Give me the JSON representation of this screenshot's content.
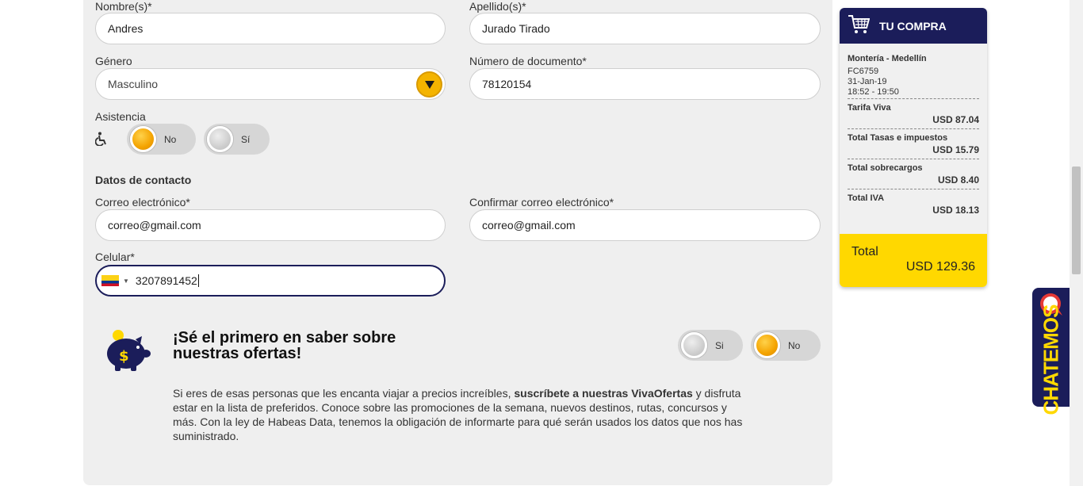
{
  "form": {
    "nombres_label": "Nombre(s)*",
    "nombres_value": "Andres",
    "apellidos_label": "Apellido(s)*",
    "apellidos_value": "Jurado Tirado",
    "genero_label": "Género",
    "genero_value": "Masculino",
    "documento_label": "Número de documento*",
    "documento_value": "78120154",
    "asistencia_label": "Asistencia",
    "asistencia_no": "No",
    "asistencia_si": "Sí",
    "contacto_title": "Datos de contacto",
    "correo_label": "Correo electrónico*",
    "correo_value": "correo@gmail.com",
    "confirmar_label": "Confirmar correo electrónico*",
    "confirmar_value": "correo@gmail.com",
    "celular_label": "Celular*",
    "celular_value": "3207891452"
  },
  "promo": {
    "title": "¡Sé el primero en saber sobre nuestras ofertas!",
    "si": "Si",
    "no": "No",
    "text_before": "Si eres de esas personas que les encanta viajar a precios increíbles, ",
    "text_bold": "suscríbete a nuestras VivaOfertas",
    "text_after": " y disfruta estar en la lista de preferidos.  Conoce sobre las promociones de la semana, nuevos destinos, rutas, concursos y más. Con la ley de Habeas Data, tenemos la obligación de informarte para qué serán usados los datos que nos has suministrado."
  },
  "cart": {
    "title": "TU COMPRA",
    "route": "Montería - Medellín",
    "flight": "FC6759",
    "date": "31-Jan-19",
    "time": "18:52 - 19:50",
    "rows": [
      {
        "label": "Tarifa Viva",
        "value": "USD 87.04"
      },
      {
        "label": "Total Tasas e impuestos",
        "value": "USD 15.79"
      },
      {
        "label": "Total sobrecargos",
        "value": "USD 8.40"
      },
      {
        "label": "Total IVA",
        "value": "USD 18.13"
      }
    ],
    "total_label": "Total",
    "total_value": "USD 129.36"
  },
  "chat": {
    "label": "CHATEMOS"
  },
  "colors": {
    "brand_navy": "#1b1d5a",
    "brand_yellow": "#ffd800",
    "accent_orange": "#f4b400"
  }
}
